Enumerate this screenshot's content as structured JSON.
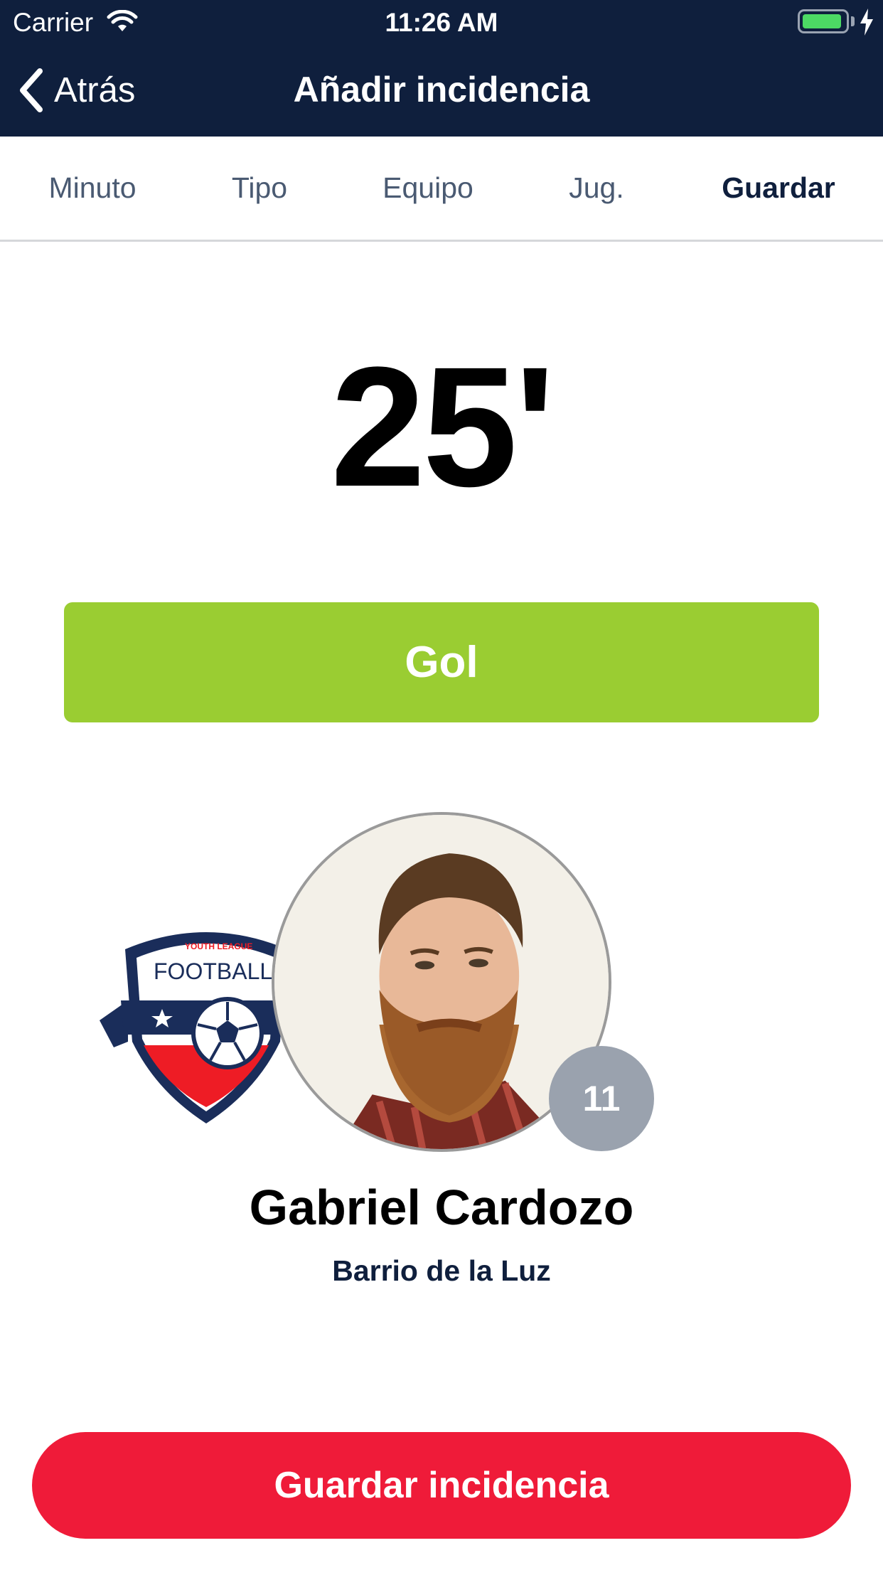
{
  "status_bar": {
    "carrier": "Carrier",
    "time": "11:26 AM",
    "battery_color": "#4cd964"
  },
  "nav": {
    "back_label": "Atrás",
    "title": "Añadir incidencia",
    "background": "#0f1f3d"
  },
  "steps": [
    {
      "label": "Minuto",
      "active": false
    },
    {
      "label": "Tipo",
      "active": false
    },
    {
      "label": "Equipo",
      "active": false
    },
    {
      "label": "Jug.",
      "active": false
    },
    {
      "label": "Guardar",
      "active": true
    }
  ],
  "incident": {
    "minute": "25'",
    "type_label": "Gol",
    "type_color": "#9acd32"
  },
  "team_logo": {
    "top_text": "YOUTH LEAGUE",
    "main_text": "FOOTBALL CLU"
  },
  "player": {
    "number": "11",
    "name": "Gabriel Cardozo",
    "team": "Barrio de la Luz"
  },
  "actions": {
    "save_label": "Guardar incidencia",
    "save_color": "#ef1b39"
  }
}
